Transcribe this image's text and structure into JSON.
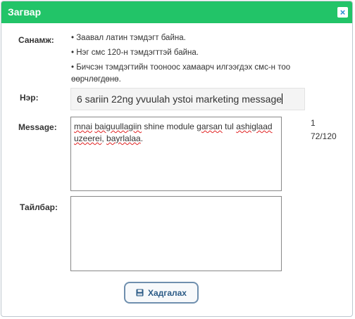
{
  "dialog": {
    "title": "Загвар",
    "close_symbol": "×"
  },
  "labels": {
    "note": "Санамж:",
    "name": "Нэр:",
    "message": "Message:",
    "description": "Тайлбар:"
  },
  "notes": [
    "• Заавал латин тэмдэгт байна.",
    "• Нэг смс 120-н тэмдэгттэй байна.",
    "• Бичсэн тэмдэгтийн тооноос хамаарч илгээгдэх смс-н тоо өөрчлөгдөнө."
  ],
  "name_value": "6 sariin 22ng yvuulah ystoi marketing message",
  "message_parts": {
    "p1": "mnai",
    "p2": " ",
    "p3": "baiguullagiin",
    "p4": " shine module ",
    "p5": "garsan",
    "p6": " tul ",
    "p7": "ashiglaad",
    "p8": " ",
    "p9": "uzeerei",
    "p10": ", ",
    "p11": "bayrlalaa",
    "p12": "."
  },
  "description_value": "",
  "counter": {
    "sms_count": "1",
    "chars": "72/120"
  },
  "save_button": {
    "label": "Хадгалах",
    "icon": "save-icon"
  }
}
